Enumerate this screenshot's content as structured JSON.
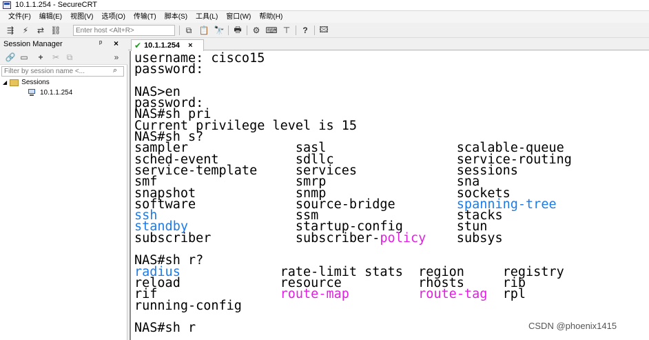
{
  "window": {
    "title": "10.1.1.254 - SecureCRT"
  },
  "menu": [
    "文件(F)",
    "编辑(E)",
    "视图(V)",
    "选项(O)",
    "传输(T)",
    "脚本(S)",
    "工具(L)",
    "窗口(W)",
    "帮助(H)"
  ],
  "toolbar": {
    "quick_connect_placeholder": "Enter host <Alt+R>"
  },
  "session_manager": {
    "title": "Session Manager",
    "pin_symbol": "ᵖ",
    "close_symbol": "×",
    "more_symbol": "»",
    "filter_placeholder": "Filter by session name <...",
    "tree_root": "Sessions",
    "tree_items": [
      "10.1.1.254"
    ]
  },
  "tabs": [
    {
      "label": "10.1.1.254",
      "active": true
    }
  ],
  "terminal": {
    "lines": [
      [
        {
          "t": "username: cisco15"
        }
      ],
      [
        {
          "t": "password:"
        }
      ],
      [
        {
          "t": ""
        }
      ],
      [
        {
          "t": "NAS>en"
        }
      ],
      [
        {
          "t": "password:"
        }
      ],
      [
        {
          "t": "NAS#sh pri"
        }
      ],
      [
        {
          "t": "Current privilege level is 15"
        }
      ],
      [
        {
          "t": "NAS#sh s?"
        }
      ],
      [
        {
          "t": "sampler              sasl                 scalable-queue"
        }
      ],
      [
        {
          "t": "sched-event          sdllc                service-routing"
        }
      ],
      [
        {
          "t": "service-template     services             sessions"
        }
      ],
      [
        {
          "t": "smf                  smrp                 sna"
        }
      ],
      [
        {
          "t": "snapshot             snmp                 sockets"
        }
      ],
      [
        {
          "t": "software             source-bridge        "
        },
        {
          "t": "spanning-tree",
          "c": "blue"
        }
      ],
      [
        {
          "t": "ssh",
          "c": "blue"
        },
        {
          "t": "                  ssm                  stacks"
        }
      ],
      [
        {
          "t": "standby",
          "c": "blue"
        },
        {
          "t": "              startup-config       stun"
        }
      ],
      [
        {
          "t": "subscriber           subscriber-"
        },
        {
          "t": "policy",
          "c": "magenta"
        },
        {
          "t": "    subsys"
        }
      ],
      [
        {
          "t": ""
        }
      ],
      [
        {
          "t": "NAS#sh r?"
        }
      ],
      [
        {
          "t": "radius",
          "c": "blue"
        },
        {
          "t": "             rate-limit stats  region     registry"
        }
      ],
      [
        {
          "t": "reload             resource          rhosts     rib"
        }
      ],
      [
        {
          "t": "rif                "
        },
        {
          "t": "route-map",
          "c": "magenta"
        },
        {
          "t": "         "
        },
        {
          "t": "route-tag",
          "c": "magenta"
        },
        {
          "t": "  rpl"
        }
      ],
      [
        {
          "t": "running-config"
        }
      ],
      [
        {
          "t": ""
        }
      ],
      [
        {
          "t": "NAS#sh r"
        }
      ]
    ]
  },
  "watermark": "CSDN @phoenix1415"
}
